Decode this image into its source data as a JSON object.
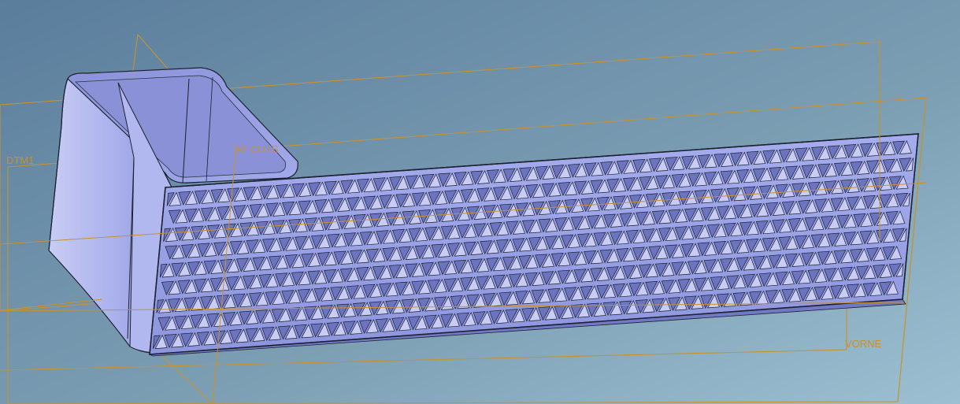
{
  "viewport": {
    "background_top": "#5f82a0",
    "background_bottom": "#96b8c8"
  },
  "datum_planes": [
    {
      "name": "datum-plane-dtm1",
      "label": "DTM1"
    },
    {
      "name": "datum-plane-rechts",
      "label": "RECHTS"
    },
    {
      "name": "datum-plane-vorne",
      "label": "VORNE"
    }
  ],
  "colors": {
    "datum_plane": "#c8912e",
    "model_face": "#9aa3e6",
    "model_face_light": "#c9cdf5",
    "model_face_dark": "#7b82c8",
    "model_edge": "#1d2230",
    "knurl_hole": "#6d74bf"
  },
  "model": {
    "name": "door-handle-lever",
    "surface_pattern": "triangular-knurl"
  }
}
